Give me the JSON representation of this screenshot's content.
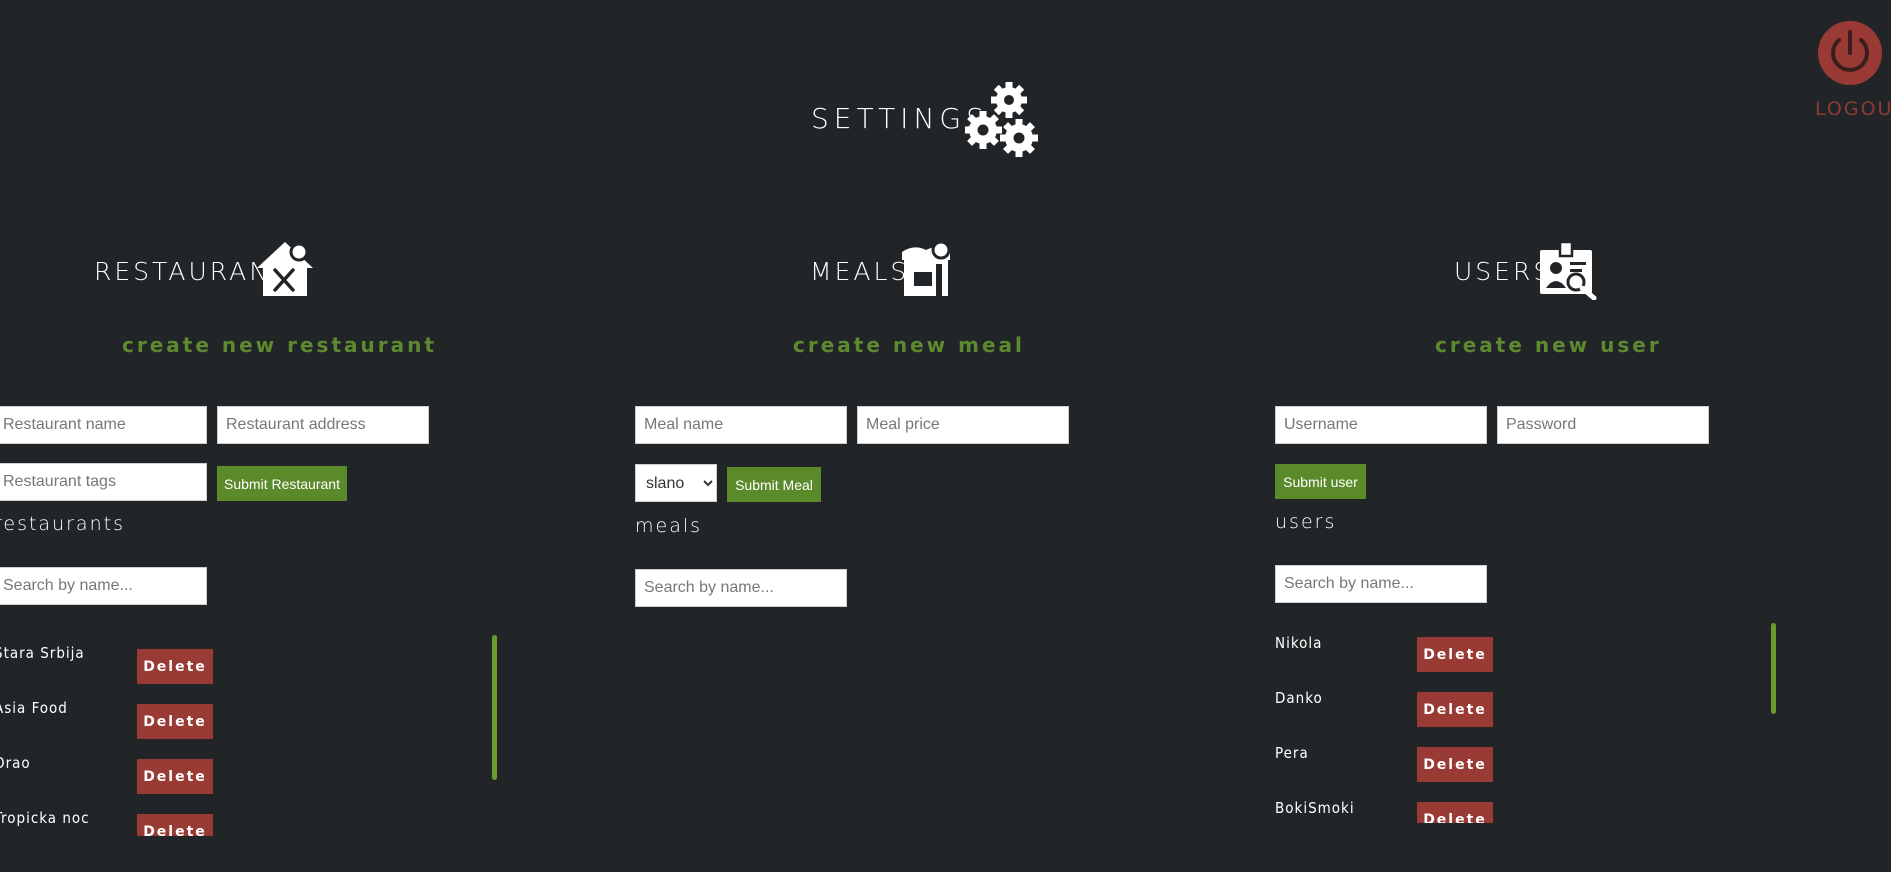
{
  "header": {
    "title": "SETTINGS",
    "logout_label": "LOGOUT"
  },
  "colors": {
    "background": "#222528",
    "accent_green": "#5a8a2a",
    "danger_red": "#9a3a35"
  },
  "icons": {
    "title": "gears-icon",
    "logout": "power-icon",
    "restaurants": "restaurant-house-icon",
    "meals": "shop-icon",
    "users": "user-badge-search-icon"
  },
  "restaurants": {
    "title": "RESTAURANTS",
    "create_label": "create new restaurant",
    "name_placeholder": "Restaurant name",
    "address_placeholder": "Restaurant address",
    "tags_placeholder": "Restaurant tags",
    "submit_label": "Submit Restaurant",
    "list_heading": "restaurants",
    "search_placeholder": "Search by name...",
    "delete_label": "Delete",
    "items": [
      "Stara Srbija",
      "Asia Food",
      "Orao",
      "Tropicka noc"
    ]
  },
  "meals": {
    "title": "MEALS",
    "create_label": "create new meal",
    "name_placeholder": "Meal name",
    "price_placeholder": "Meal price",
    "type_selected": "slano",
    "submit_label": "Submit Meal",
    "list_heading": "meals",
    "search_placeholder": "Search by name..."
  },
  "users": {
    "title": "USERS",
    "create_label": "create new user",
    "username_placeholder": "Username",
    "password_placeholder": "Password",
    "submit_label": "Submit user",
    "list_heading": "users",
    "search_placeholder": "Search by name...",
    "delete_label": "Delete",
    "items": [
      "Nikola",
      "Danko",
      "Pera",
      "BokiSmoki"
    ]
  }
}
